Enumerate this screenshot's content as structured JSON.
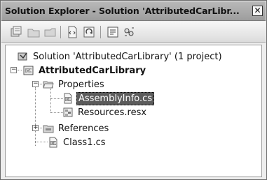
{
  "window": {
    "title": "Solution Explorer - Solution 'AttributedCarLibr...",
    "close_glyph": "✕"
  },
  "toolbar": {
    "buttons": [
      {
        "icon": "properties-icon"
      },
      {
        "icon": "show-all-files-icon"
      },
      {
        "icon": "refresh-icon"
      },
      {
        "icon": "view-code-icon"
      },
      {
        "icon": "view-designer-icon"
      },
      {
        "icon": "view-class-diagram-icon"
      },
      {
        "icon": "class-view-icon"
      }
    ]
  },
  "tree": {
    "solution_label": "Solution 'AttributedCarLibrary' (1 project)",
    "project_label": "AttributedCarLibrary",
    "properties_label": "Properties",
    "assemblyinfo_label": "AssemblyInfo.cs",
    "resources_label": "Resources.resx",
    "references_label": "References",
    "class1_label": "Class1.cs",
    "expander_collapse": "−",
    "expander_expand": "+"
  }
}
